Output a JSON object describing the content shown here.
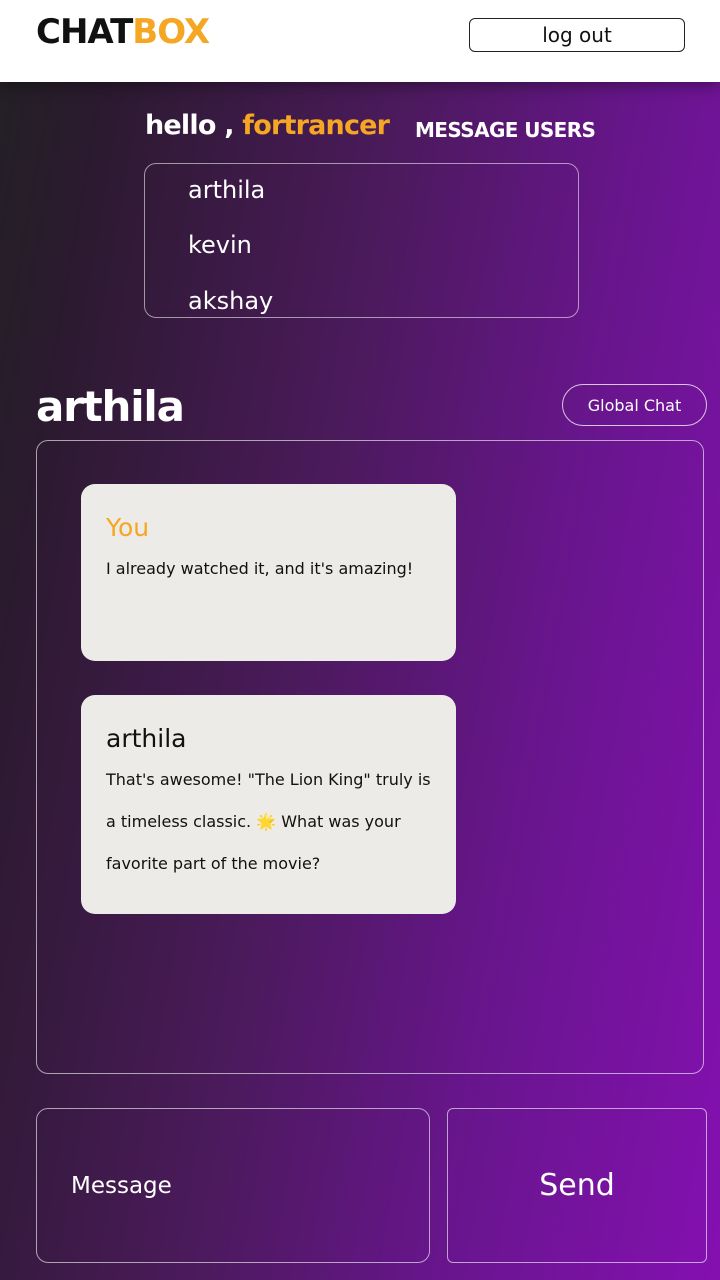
{
  "header": {
    "logo_part1": "CHAT",
    "logo_part2": "BOX",
    "logout_label": "log out"
  },
  "greeting": {
    "hello": "hello ,",
    "username": "fortrancer",
    "message_users_label": "MESSAGE USERS"
  },
  "users": [
    "arthila",
    "kevin",
    "akshay"
  ],
  "chat": {
    "title": "arthila",
    "global_chat_label": "Global Chat",
    "messages": [
      {
        "sender": "You",
        "text": "I already watched it, and it's amazing!"
      },
      {
        "sender": "arthila",
        "text": "That's awesome! \"The Lion King\" truly is a timeless classic. 🌟 What was your favorite part of the movie?"
      }
    ]
  },
  "composer": {
    "placeholder": "Message",
    "send_label": "Send"
  },
  "colors": {
    "accent": "#f5a623",
    "gradient_start": "#232025",
    "gradient_end": "#8410b0",
    "bubble": "#edebe8"
  }
}
